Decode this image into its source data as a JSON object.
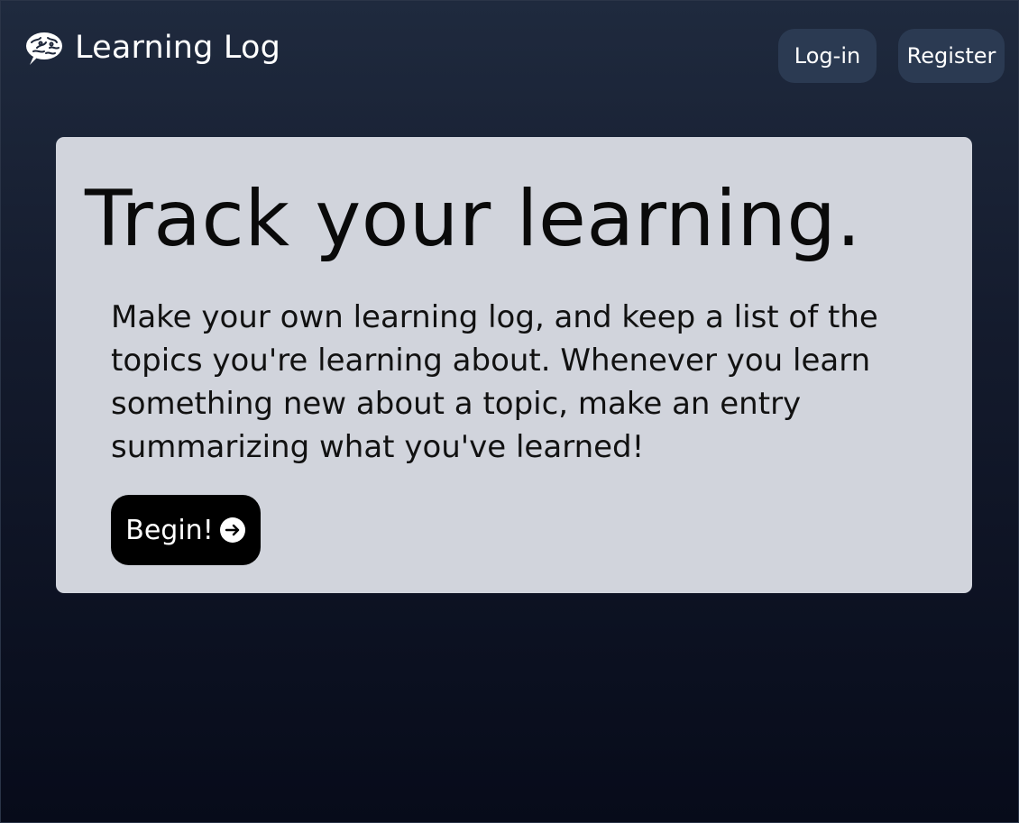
{
  "navbar": {
    "brand_icon": "brain-icon",
    "brand_title": "Learning Log",
    "login_label": "Log-in",
    "register_label": "Register"
  },
  "hero": {
    "title": "Track your learning.",
    "description": "Make your own learning log, and keep a list of the topics you're learning about. Whenever you learn something new about a topic, make an entry summarizing what you've learned!",
    "begin_label": "Begin!",
    "begin_icon": "arrow-right-circle-icon"
  },
  "colors": {
    "background_top": "#1f2a3e",
    "background_bottom": "#070b1a",
    "card": "#d1d4dc",
    "nav_button": "#2b3a52",
    "primary_button": "#000000"
  }
}
